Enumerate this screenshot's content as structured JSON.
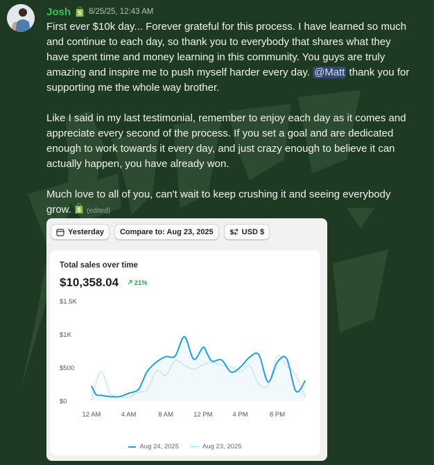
{
  "message": {
    "author": "Josh",
    "timestamp": "8/25/25, 12:43 AM",
    "paragraph1_a": "First ever $10k day... Forever grateful for this process. I have learned so much and continue to each day, so thank you to everybody that shares what they have spent time and money learning in this community. You guys are truly amazing and inspire me to push myself harder every day. ",
    "mention": "@Matt",
    "paragraph1_b": " thank you for supporting me the whole way brother.",
    "paragraph2": "Like I said in my last testimonial, remember to enjoy each day as it comes and appreciate every second of the process. If you set a goal and are dedicated enough to work towards it every day, and just crazy enough to believe it can actually happen, you have already won.",
    "paragraph3": "Much love to all of you, can't wait to keep crushing it and seeing everybody grow. ",
    "edited": "(edited)"
  },
  "colors": {
    "username": "#3fbf5a",
    "background": "#1f3a23",
    "series_primary": "#1ba1e2",
    "series_compare": "#83c8ec",
    "positive_change": "#2e9a4b"
  },
  "icons": {
    "role_badge": "shopify-bag-icon",
    "date_filter": "calendar-icon",
    "currency_filter": "currency-exchange-icon",
    "change_arrow": "arrow-up-right-icon"
  },
  "filters": {
    "date": "Yesterday",
    "compare": "Compare to: Aug 23, 2025",
    "currency": "USD $"
  },
  "card": {
    "title": "Total sales over time",
    "total": "$10,358.04",
    "change": "21%"
  },
  "chart_data": {
    "type": "line",
    "title": "Total sales over time",
    "xlabel": "",
    "ylabel": "",
    "ylim": [
      0,
      1500
    ],
    "y_ticks": [
      "$1.5K",
      "$1K",
      "$500",
      "$0"
    ],
    "y_tick_values": [
      1500,
      1000,
      500,
      0
    ],
    "x_ticks": [
      "12 AM",
      "4 AM",
      "8 AM",
      "12 PM",
      "4 PM",
      "8 PM"
    ],
    "x_tick_hours": [
      0,
      4,
      8,
      12,
      16,
      20
    ],
    "grid": false,
    "legend": "bottom",
    "series": [
      {
        "name": "Aug 24, 2025",
        "style": "solid",
        "x": [
          0,
          0.5,
          1,
          2,
          3,
          4,
          5,
          5.5,
          6,
          7,
          8,
          9,
          10,
          11,
          12,
          12.5,
          13,
          14,
          15,
          16,
          17,
          18,
          19,
          20,
          21,
          22,
          23
        ],
        "y": [
          230,
          100,
          90,
          70,
          70,
          120,
          170,
          300,
          450,
          590,
          670,
          680,
          970,
          630,
          810,
          700,
          600,
          620,
          440,
          510,
          660,
          700,
          290,
          590,
          640,
          150,
          310
        ]
      },
      {
        "name": "Aug 23, 2025",
        "style": "dotted",
        "x": [
          0,
          1,
          2,
          3,
          4,
          5,
          6,
          7,
          8,
          9,
          10,
          11,
          12,
          13,
          14,
          15,
          16,
          17,
          18,
          19,
          20,
          21,
          22,
          23
        ],
        "y": [
          20,
          450,
          120,
          70,
          60,
          130,
          180,
          450,
          390,
          610,
          540,
          480,
          550,
          580,
          540,
          520,
          440,
          530,
          260,
          240,
          680,
          530,
          390,
          60
        ]
      }
    ]
  }
}
